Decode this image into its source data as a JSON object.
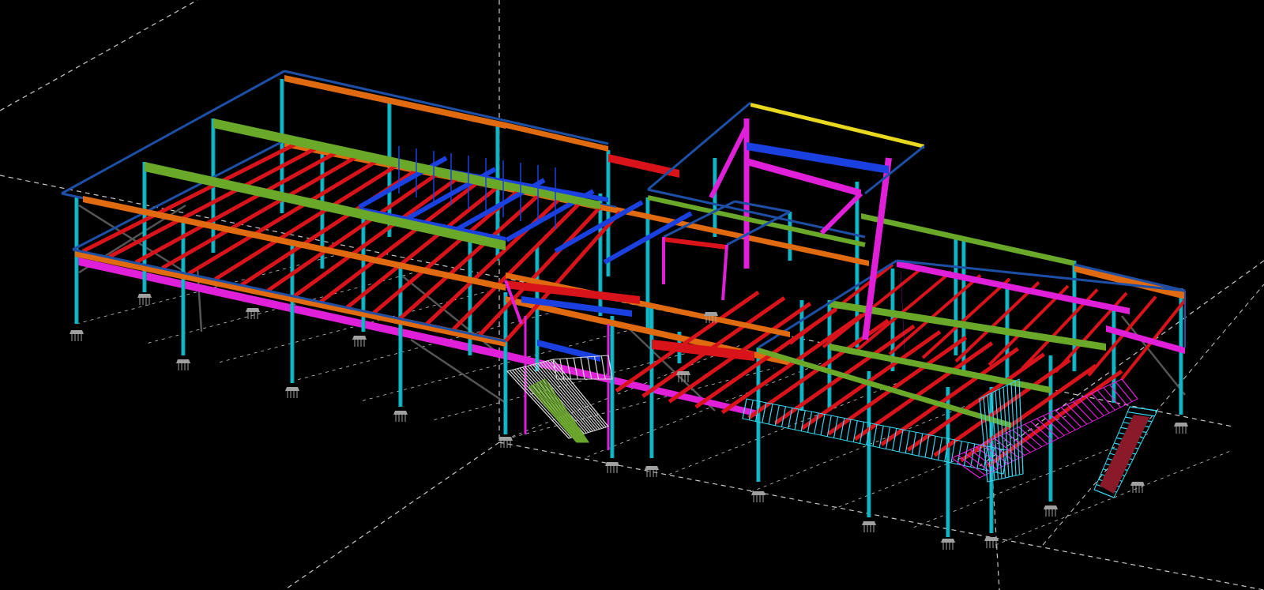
{
  "viewport": {
    "background": "#000000",
    "view": "3d-isometric-structural-model"
  },
  "palette": {
    "grid": "#c8c8c8",
    "column": "#12b7c8",
    "column_dark": "#0b8fa0",
    "edge_beam": "#1d4fa6",
    "girder_orange": "#e06a10",
    "joist_red": "#d8141a",
    "beam_green": "#6aa82a",
    "beam_magenta": "#e01fd8",
    "beam_blue": "#1a40e0",
    "beam_yellow": "#e8d820",
    "stair_white": "#d8d8d8",
    "stair_cyan": "#38d4f0",
    "brace_gray": "#555555",
    "base_plate": "#a0a0a0"
  },
  "elements": {
    "columns": "structural-column",
    "beams": "structural-beam",
    "joists": "floor-joist",
    "braces": "cross-brace",
    "stairs": "stair-assembly",
    "footings": "column-base-plate"
  }
}
